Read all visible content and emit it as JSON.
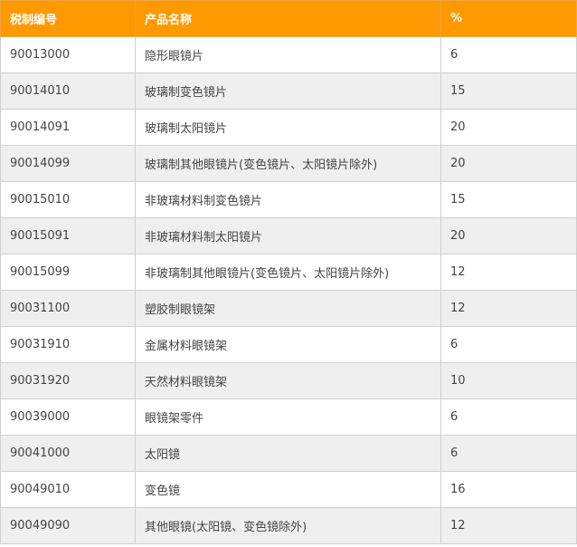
{
  "table": {
    "headers": [
      "税制编号",
      "产品名称",
      "%"
    ],
    "rows": [
      [
        "90013000",
        "隐形眼镜片",
        "6"
      ],
      [
        "90014010",
        "玻璃制变色镜片",
        "15"
      ],
      [
        "90014091",
        "玻璃制太阳镜片",
        "20"
      ],
      [
        "90014099",
        "玻璃制其他眼镜片(变色镜片、太阳镜片除外)",
        "20"
      ],
      [
        "90015010",
        "非玻璃材料制变色镜片",
        "15"
      ],
      [
        "90015091",
        "非玻璃材料制太阳镜片",
        "20"
      ],
      [
        "90015099",
        "非玻璃制其他眼镜片(变色镜片、太阳镜片除外)",
        "12"
      ],
      [
        "90031100",
        "塑胶制眼镜架",
        "12"
      ],
      [
        "90031910",
        "金属材料眼镜架",
        "6"
      ],
      [
        "90031920",
        "天然材料眼镜架",
        "10"
      ],
      [
        "90039000",
        "眼镜架零件",
        "6"
      ],
      [
        "90041000",
        "太阳镜",
        "6"
      ],
      [
        "90049010",
        "变色镜",
        "16"
      ],
      [
        "90049090",
        "其他眼镜(太阳镜、变色镜除外)",
        "12"
      ]
    ]
  },
  "colors": {
    "header_bg": "#ff9900",
    "header_text": "#ffffff",
    "row_alt_bg": "#efefef",
    "border": "#cfcfcf",
    "text": "#444444"
  }
}
